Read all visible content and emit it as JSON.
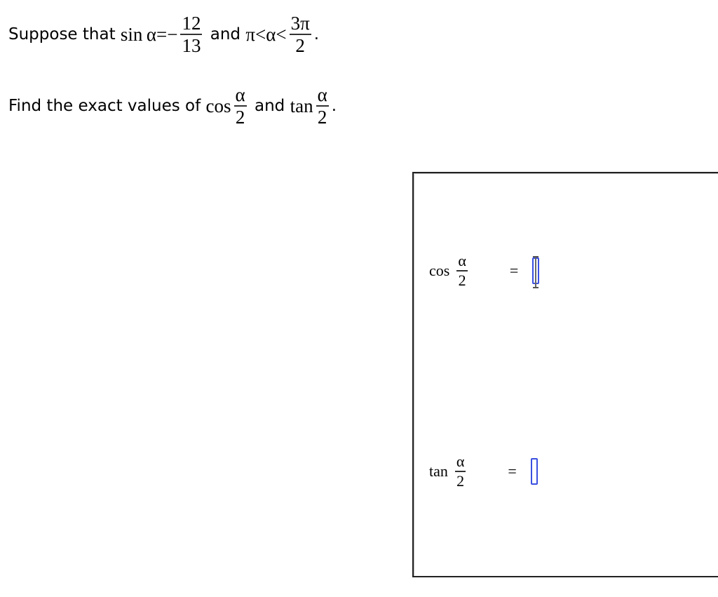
{
  "problem": {
    "line1": {
      "prefix": "Suppose that ",
      "func": "sin α",
      "equals": "=−",
      "frac1_num": "12",
      "frac1_den": "13",
      "middle": " and ",
      "ineq": "π<α<",
      "frac2_num": "3π",
      "frac2_den": "2",
      "end": "."
    },
    "line2": {
      "prefix": "Find the exact values of ",
      "func1": "cos",
      "frac_num": "α",
      "frac_den": "2",
      "middle": " and ",
      "func2": "tan",
      "end": "."
    }
  },
  "answer_panel": {
    "rows": [
      {
        "func": "cos",
        "num": "α",
        "den": "2",
        "equals": "=",
        "value": "",
        "focused": true
      },
      {
        "func": "tan",
        "num": "α",
        "den": "2",
        "equals": "=",
        "value": "",
        "focused": false
      }
    ]
  },
  "colors": {
    "input_border": "#3a4fe0",
    "panel_border": "#222222"
  }
}
